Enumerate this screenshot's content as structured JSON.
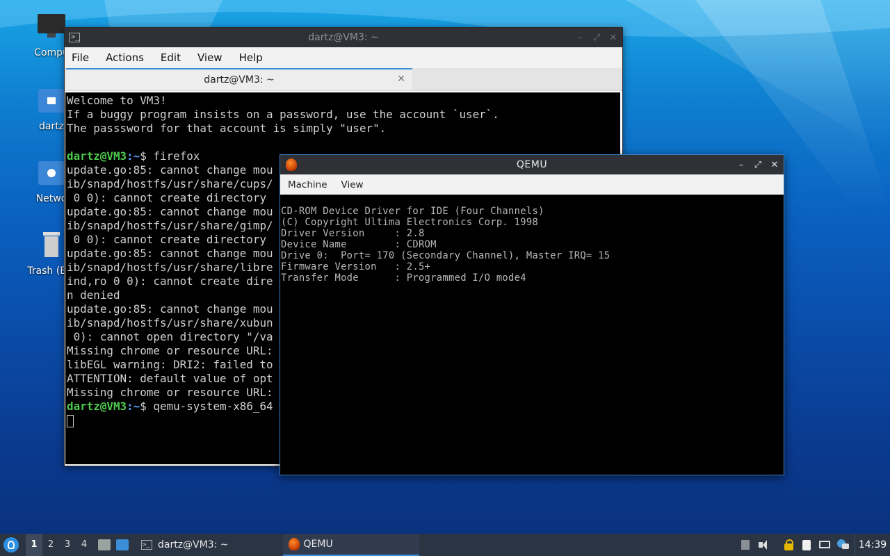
{
  "desktop": {
    "icons": [
      {
        "label": "Compu"
      },
      {
        "label": "dartz"
      },
      {
        "label": "Netwo"
      },
      {
        "label": "Trash (Em"
      }
    ]
  },
  "terminal": {
    "title": "dartz@VM3: ~",
    "menu": [
      "File",
      "Actions",
      "Edit",
      "View",
      "Help"
    ],
    "tab_title": "dartz@VM3: ~",
    "tab_close": "×",
    "lines": [
      {
        "text": "Welcome to VM3!"
      },
      {
        "text": "If a buggy program insists on a password, use the account `user`."
      },
      {
        "text": "The passsword for that account is simply \"user\"."
      },
      {
        "text": ""
      },
      {
        "prompt": "dartz@VM3",
        "path": ":~",
        "text": "$ firefox"
      },
      {
        "text": "update.go:85: cannot change mou"
      },
      {
        "text": "ib/snapd/hostfs/usr/share/cups/"
      },
      {
        "text": " 0 0): cannot create directory "
      },
      {
        "text": "update.go:85: cannot change mou"
      },
      {
        "text": "ib/snapd/hostfs/usr/share/gimp/"
      },
      {
        "text": " 0 0): cannot create directory "
      },
      {
        "text": "update.go:85: cannot change mou"
      },
      {
        "text": "ib/snapd/hostfs/usr/share/libre"
      },
      {
        "text": "ind,ro 0 0): cannot create dire"
      },
      {
        "text": "n denied"
      },
      {
        "text": "update.go:85: cannot change mou"
      },
      {
        "text": "ib/snapd/hostfs/usr/share/xubun"
      },
      {
        "text": " 0): cannot open directory \"/va"
      },
      {
        "text": "Missing chrome or resource URL:"
      },
      {
        "text": "libEGL warning: DRI2: failed to"
      },
      {
        "text": "ATTENTION: default value of opt"
      },
      {
        "text": "Missing chrome or resource URL:"
      },
      {
        "prompt": "dartz@VM3",
        "path": ":~",
        "text": "$ qemu-system-x86_64"
      }
    ]
  },
  "qemu": {
    "title": "QEMU",
    "menu": [
      "Machine",
      "View"
    ],
    "screen_lines": [
      "CD-ROM Device Driver for IDE (Four Channels)",
      "(C) Copyright Ultima Electronics Corp. 1998",
      "Driver Version     : 2.8",
      "Device Name        : CDROM",
      "Drive 0:  Port= 170 (Secondary Channel), Master IRQ= 15",
      "Firmware Version   : 2.5+",
      "Transfer Mode      : Programmed I/O mode4"
    ]
  },
  "taskbar": {
    "workspaces": [
      "1",
      "2",
      "3",
      "4"
    ],
    "active_workspace": "1",
    "tasks": [
      {
        "label": "dartz@VM3: ~",
        "icon": "terminal-icon"
      },
      {
        "label": "QEMU",
        "icon": "qemu-icon"
      }
    ],
    "clock": "14:39"
  },
  "colors": {
    "accent": "#3a8fd8",
    "prompt_green": "#4ec94e",
    "titlebar": "#2f3136",
    "taskbar": "#2a3443"
  }
}
